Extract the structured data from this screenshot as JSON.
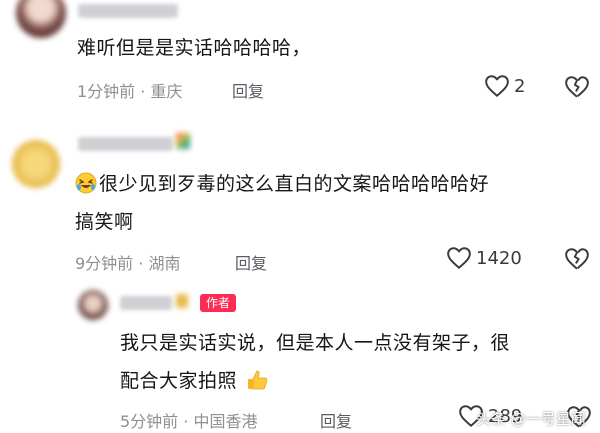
{
  "comments": [
    {
      "text": "难听但是是实话哈哈哈哈，",
      "time": "1分钟前",
      "location": "重庆",
      "reply_label": "回复",
      "likes": "2"
    },
    {
      "text_line1": "很少见到歹毒的这么直白的文案哈哈哈哈哈好",
      "text_line2": "搞笑啊",
      "time": "9分钟前",
      "location": "湖南",
      "reply_label": "回复",
      "likes": "1420"
    },
    {
      "author_badge": "作者",
      "text_line1": "我只是实话实说，但是本人一点没有架子，很",
      "text_line2": "配合大家拍照",
      "time": "5分钟前",
      "location": "中国香港",
      "reply_label": "回复",
      "likes": "289"
    }
  ],
  "separator": "·",
  "icons": {
    "like": "heart-outline-icon",
    "dislike": "broken-heart-icon",
    "laugh_emoji": "rolling-laughing-emoji",
    "thumbs_emoji": "thumbs-up-emoji"
  },
  "watermark": "头条 @一号星闻",
  "colors": {
    "badge": "#fe2c55",
    "meta": "#8f8f95",
    "text": "#161616"
  }
}
